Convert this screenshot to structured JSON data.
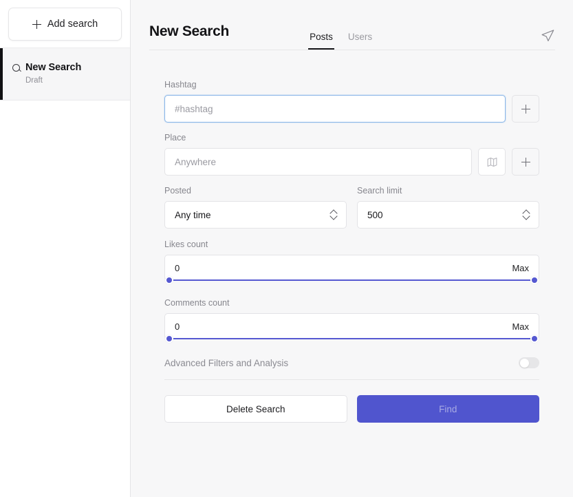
{
  "sidebar": {
    "add_search_label": "Add search",
    "add_icon": "plus-icon",
    "items": [
      {
        "icon": "magnifier-icon",
        "title": "New Search",
        "subtitle": "Draft",
        "active": true
      }
    ]
  },
  "header": {
    "title": "New Search",
    "tabs": [
      {
        "label": "Posts",
        "active": true
      },
      {
        "label": "Users",
        "active": false
      }
    ],
    "send_icon": "send-icon"
  },
  "form": {
    "hashtag": {
      "label": "Hashtag",
      "placeholder": "#hashtag",
      "value": "",
      "focused": true,
      "add_icon": "plus-icon"
    },
    "place": {
      "label": "Place",
      "placeholder": "Anywhere",
      "value": "",
      "map_icon": "map-icon",
      "add_icon": "plus-icon"
    },
    "posted": {
      "label": "Posted",
      "value": "Any time",
      "options": [
        "Any time"
      ],
      "chevron_icon": "chevron-updown-icon"
    },
    "search_limit": {
      "label": "Search limit",
      "value": "500",
      "options": [
        "500"
      ],
      "chevron_icon": "chevron-updown-icon"
    },
    "likes_count": {
      "label": "Likes count",
      "min_label": "0",
      "max_label": "Max",
      "min_percent": 0,
      "max_percent": 100
    },
    "comments_count": {
      "label": "Comments count",
      "min_label": "0",
      "max_label": "Max",
      "min_percent": 0,
      "max_percent": 100
    },
    "advanced": {
      "label": "Advanced Filters and Analysis",
      "toggle_on": false
    },
    "actions": {
      "delete_label": "Delete Search",
      "find_label": "Find"
    }
  },
  "colors": {
    "accent": "#5055ce",
    "slider": "#5558d1",
    "focus_border": "#8db8e8",
    "page_bg": "#f7f7f8"
  }
}
